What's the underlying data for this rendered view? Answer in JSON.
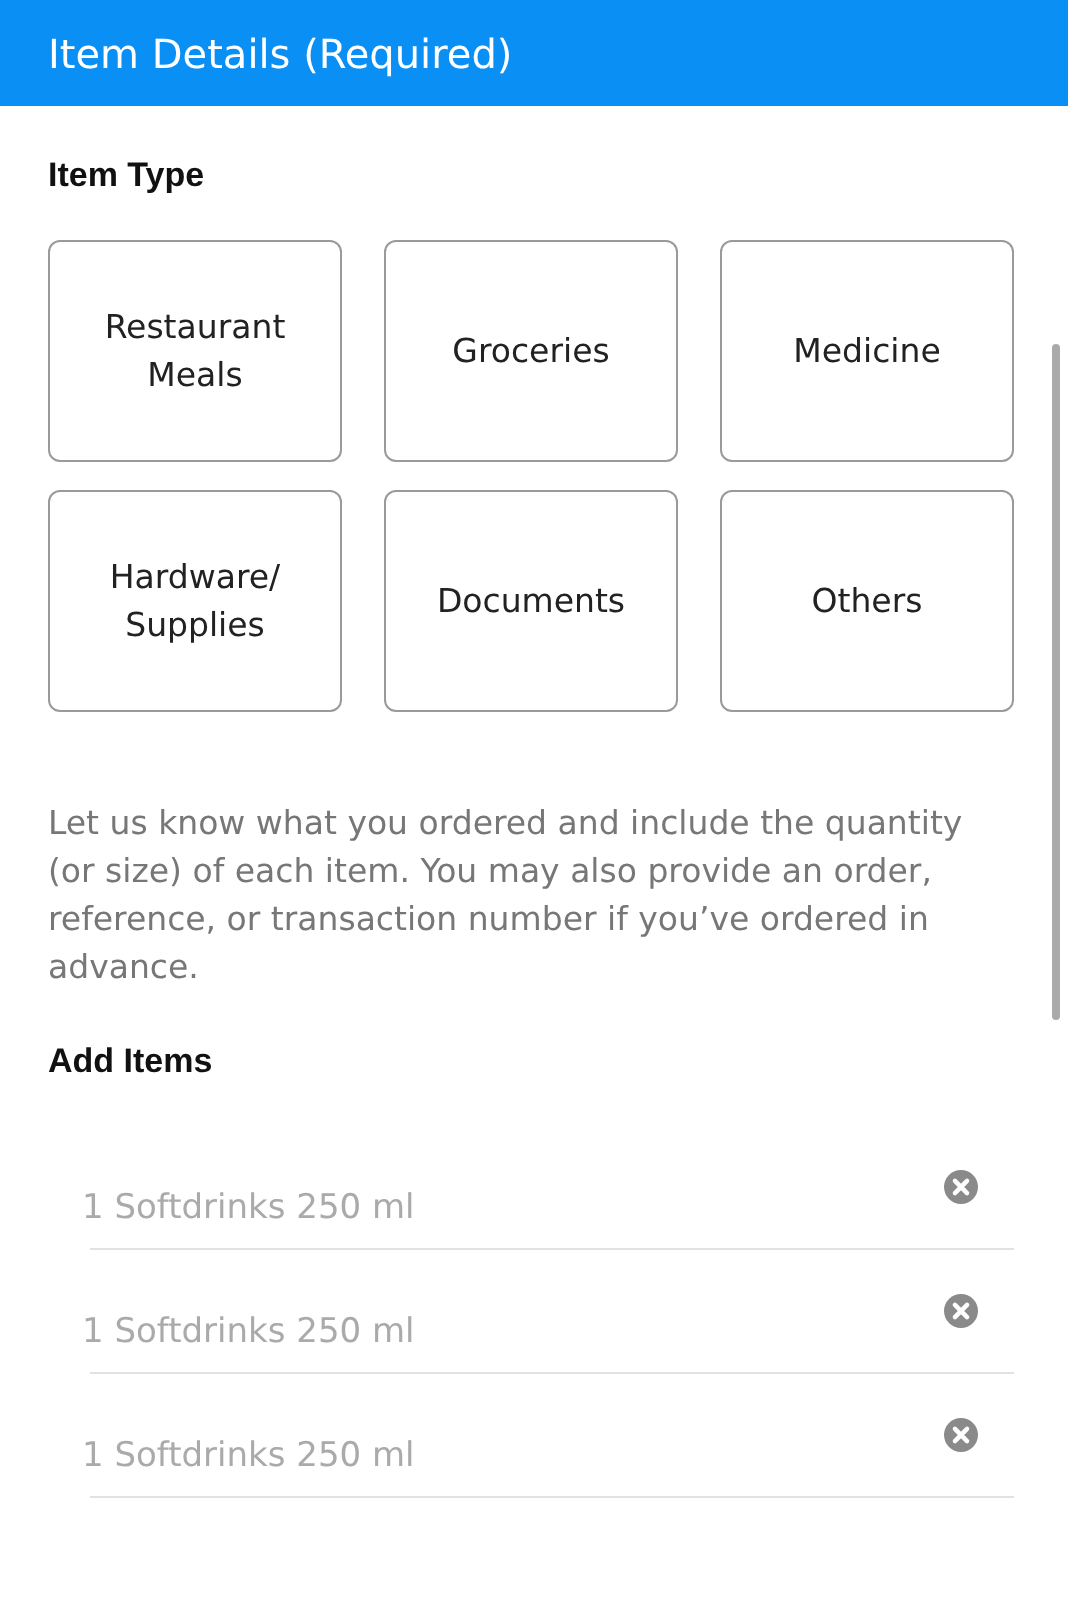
{
  "header": {
    "title": "Item Details (Required)"
  },
  "item_type": {
    "label": "Item Type",
    "options": [
      {
        "label": "Restaurant Meals",
        "selected": false
      },
      {
        "label": "Groceries",
        "selected": false
      },
      {
        "label": "Medicine",
        "selected": false
      },
      {
        "label": "Hardware/ Supplies",
        "selected": false
      },
      {
        "label": "Documents",
        "selected": false
      },
      {
        "label": "Others",
        "selected": false
      }
    ]
  },
  "instructions": "Let us know what you ordered and include the quantity (or size) of each item. You may also provide an order, reference, or transaction number if you’ve ordered in advance.",
  "add_items": {
    "label": "Add Items",
    "fields": [
      {
        "placeholder": "1 Softdrinks 250 ml"
      },
      {
        "placeholder": "1 Softdrinks 250 ml"
      },
      {
        "placeholder": "1 Softdrinks 250 ml"
      }
    ]
  }
}
